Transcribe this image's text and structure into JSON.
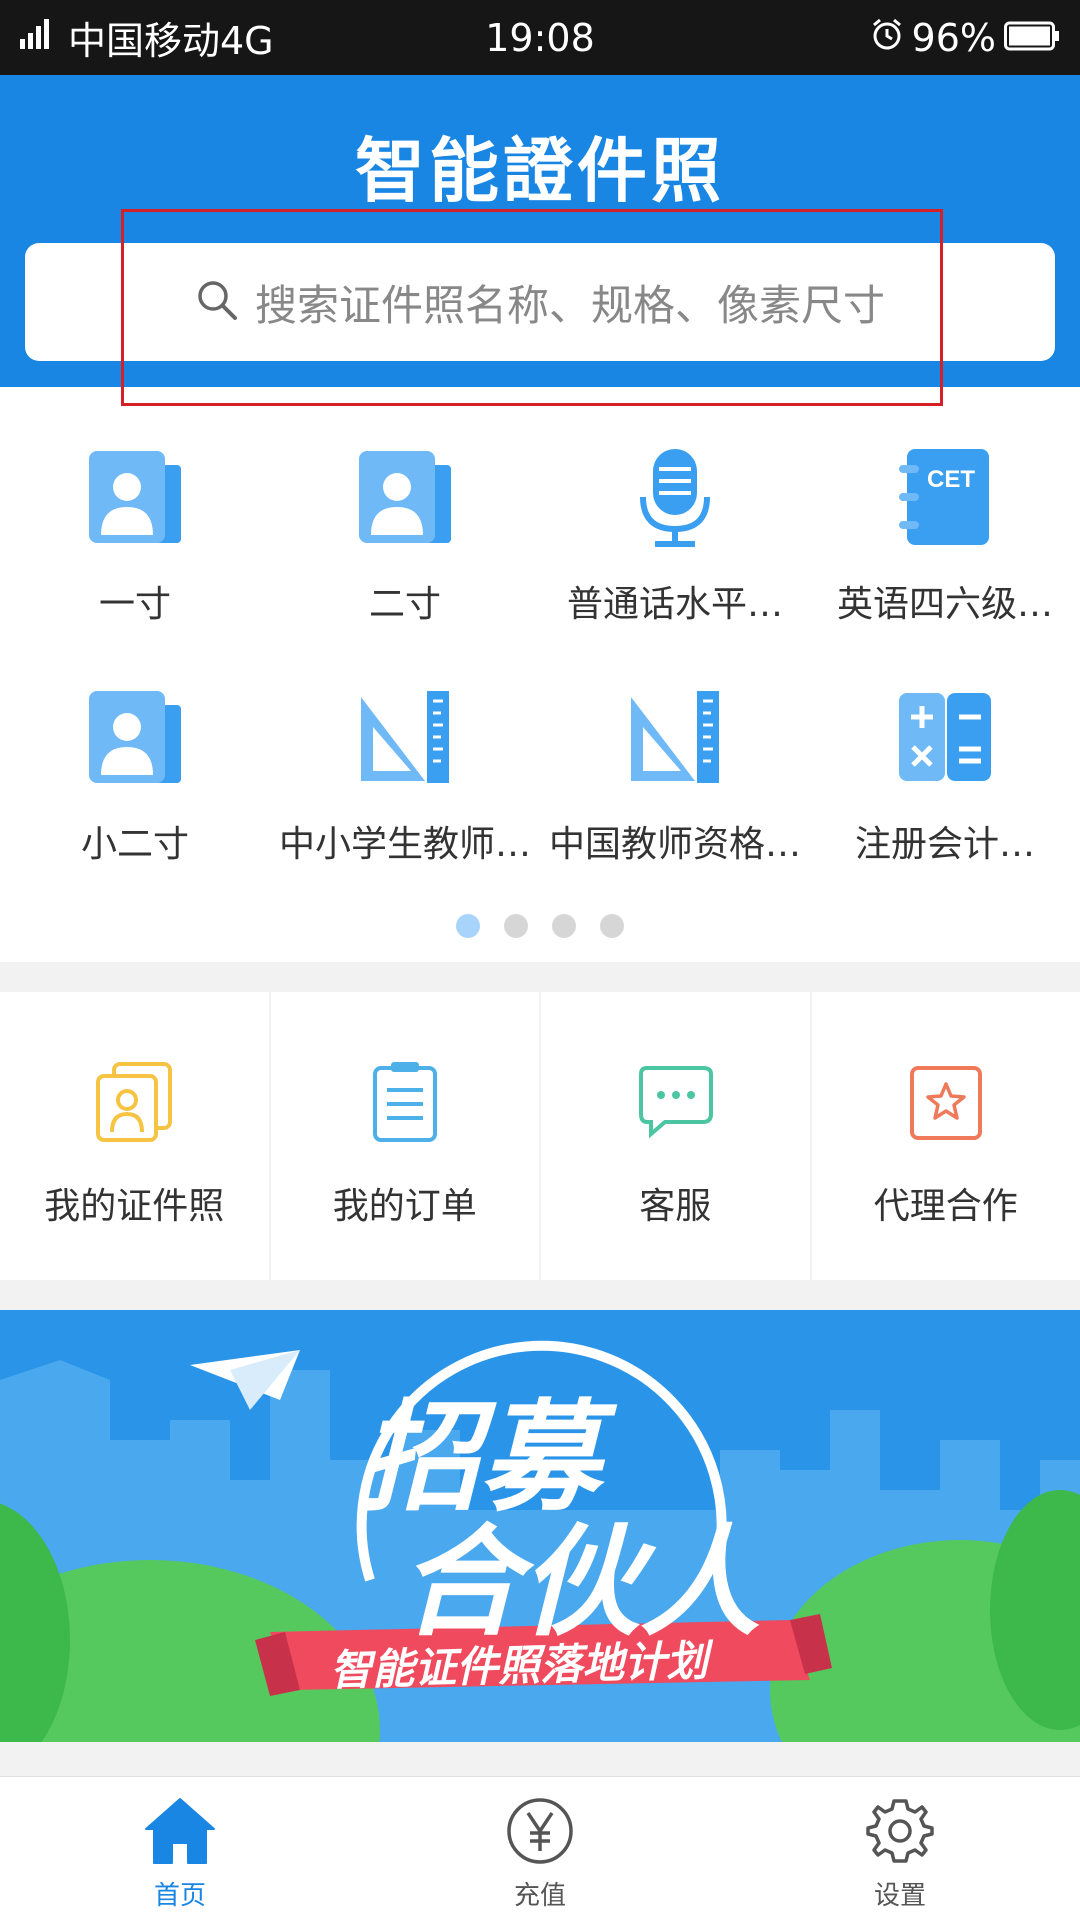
{
  "status_bar": {
    "carrier": "中国移动4G",
    "network_badge": "4G",
    "time": "19:08",
    "battery": "96%"
  },
  "header": {
    "title": "智能證件照",
    "search_placeholder": "搜索证件照名称、规格、像素尺寸"
  },
  "categories": [
    {
      "label": "一寸",
      "icon": "person-card-icon"
    },
    {
      "label": "二寸",
      "icon": "person-card-icon"
    },
    {
      "label": "普通话水平…",
      "icon": "microphone-icon"
    },
    {
      "label": "英语四六级…",
      "icon": "cet-notebook-icon",
      "icon_text": "CET"
    },
    {
      "label": "小二寸",
      "icon": "person-card-icon"
    },
    {
      "label": "中小学生教师…",
      "icon": "ruler-triangle-icon"
    },
    {
      "label": "中国教师资格…",
      "icon": "ruler-triangle-icon"
    },
    {
      "label": "注册会计…",
      "icon": "calculator-icon"
    }
  ],
  "pager": {
    "pages": 4,
    "active": 0
  },
  "actions": [
    {
      "label": "我的证件照",
      "icon": "photo-stack-icon"
    },
    {
      "label": "我的订单",
      "icon": "clipboard-icon"
    },
    {
      "label": "客服",
      "icon": "chat-bubble-icon"
    },
    {
      "label": "代理合作",
      "icon": "star-badge-icon"
    }
  ],
  "banner": {
    "line1": "招募",
    "line2": "合伙人",
    "ribbon": "智能证件照落地计划"
  },
  "tabbar": [
    {
      "label": "首页",
      "icon": "home-icon",
      "active": true
    },
    {
      "label": "充值",
      "icon": "yen-coin-icon",
      "active": false
    },
    {
      "label": "设置",
      "icon": "gear-icon",
      "active": false
    }
  ],
  "colors": {
    "primary": "#1a86e4",
    "icon_blue": "#3a9ff0",
    "highlight": "#d42027"
  }
}
